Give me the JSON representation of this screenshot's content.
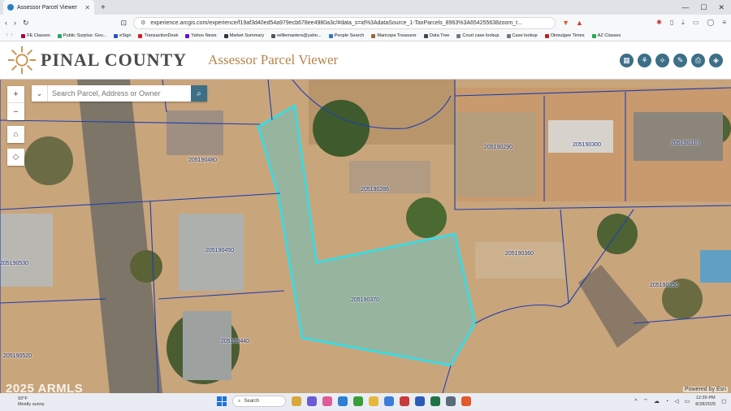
{
  "browser": {
    "tab_title": "Assessor Parcel Viewer",
    "new_tab": "+",
    "url": "experience.arcgis.com/experience/f19af3d40ed54a979ecb678ee4980a3c/#data_s=id%3AdataSource_1-TaxParcels_8963%3A654255638zoom_t...",
    "bookmarks": [
      "FE Classes",
      "Public Surplus: Gov...",
      "eSign",
      "TransactionDesk",
      "Yahoo News",
      "Market Summary",
      "williemasters@yaho...",
      "People Search",
      "Maricopa Treasurer",
      "Data Tree",
      "Court case lookup",
      "Case lookup",
      "Okmulgee Times",
      "AZ Classes"
    ]
  },
  "app": {
    "county_name": "PINAL COUNTY",
    "viewer_title": "Assessor Parcel Viewer",
    "search_placeholder": "Search Parcel, Address or Owner",
    "attribution": "Powered by Esri",
    "watermark": "2025 ARMLS"
  },
  "parcels": [
    {
      "id": "205190480"
    },
    {
      "id": "205190286"
    },
    {
      "id": "205190290"
    },
    {
      "id": "205190300"
    },
    {
      "id": "205190310"
    },
    {
      "id": "205190450"
    },
    {
      "id": "205190360"
    },
    {
      "id": "205190370"
    },
    {
      "id": "205190440"
    },
    {
      "id": "205190530"
    },
    {
      "id": "205190350"
    },
    {
      "id": "205190520"
    }
  ],
  "taskbar": {
    "temperature": "93°F",
    "weather": "Mostly sunny",
    "search_label": "Search",
    "time": "12:39 PM",
    "date": "8/28/2025"
  }
}
